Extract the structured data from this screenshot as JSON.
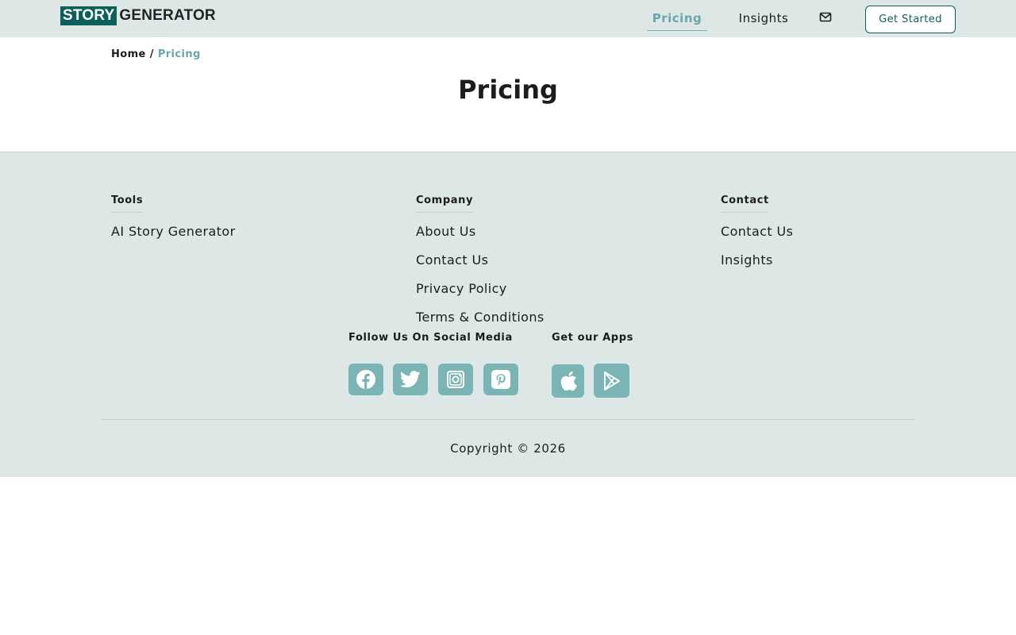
{
  "header": {
    "logo_part1": "STORY",
    "logo_part2": "GENERATOR",
    "nav": {
      "pricing": "Pricing",
      "insights": "Insights"
    },
    "mail_icon": "envelope-icon",
    "cta_label": "Get Started"
  },
  "breadcrumb": {
    "home": "Home",
    "separator": "/",
    "current": "Pricing"
  },
  "page_title": "Pricing",
  "footer": {
    "tools": {
      "title": "Tools",
      "links": [
        "AI Story Generator"
      ]
    },
    "company": {
      "title": "Company",
      "links": [
        "About Us",
        "Contact Us",
        "Privacy Policy",
        "Terms & Conditions"
      ]
    },
    "contact": {
      "title": "Contact",
      "links": [
        "Contact Us",
        "Insights"
      ]
    },
    "social_title": "Follow Us On Social Media",
    "social_icons": [
      "facebook-icon",
      "twitter-icon",
      "instagram-icon",
      "pinterest-icon"
    ],
    "apps_title": "Get our Apps",
    "app_icons": [
      "apple-icon",
      "google-play-icon"
    ],
    "copyright": "Copyright © 2026"
  },
  "colors": {
    "brand_dark": "#0d5f5b",
    "accent": "#6aa6aa",
    "header_bg": "#dde8e6",
    "icon_bg": "#7ab4b5"
  }
}
